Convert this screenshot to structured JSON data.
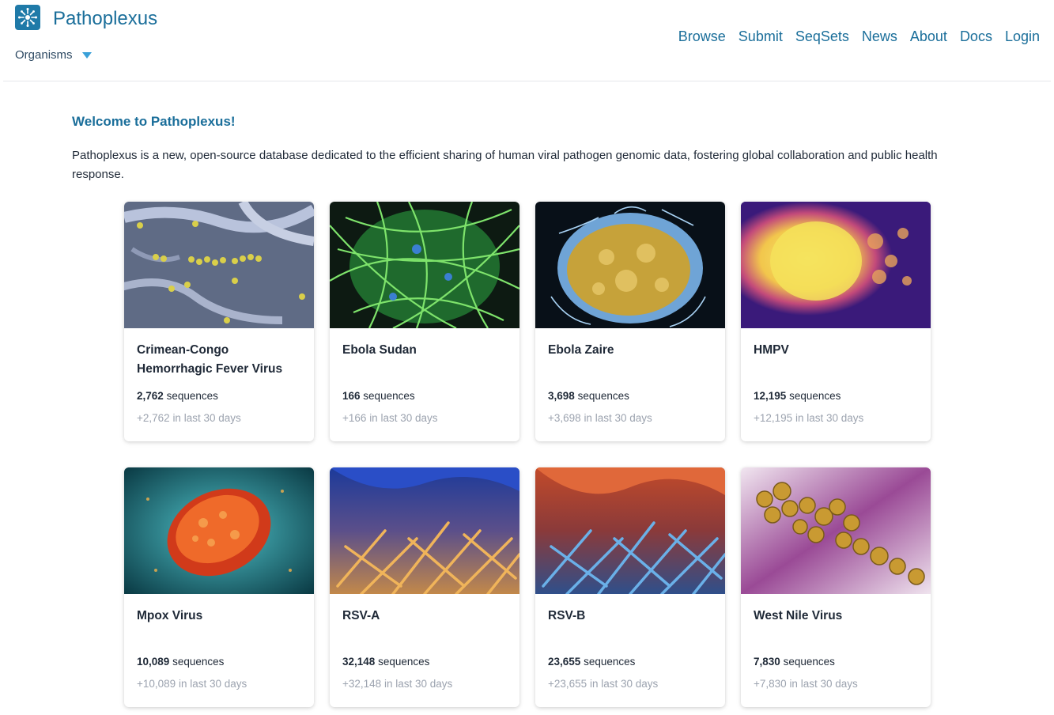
{
  "header": {
    "brand": "Pathoplexus",
    "organisms_label": "Organisms",
    "nav": [
      "Browse",
      "Submit",
      "SeqSets",
      "News",
      "About",
      "Docs",
      "Login"
    ]
  },
  "main": {
    "welcome": "Welcome to Pathoplexus!",
    "intro": "Pathoplexus is a new, open-source database dedicated to the efficient sharing of human viral pathogen genomic data, fostering global collaboration and public health response."
  },
  "cards": [
    {
      "title": "Crimean-Congo Hemorrhagic Fever Virus",
      "count": "2,762",
      "count_suffix": "sequences",
      "recent": "+2,762",
      "recent_suffix": "in last 30 days"
    },
    {
      "title": "Ebola Sudan",
      "count": "166",
      "count_suffix": "sequences",
      "recent": "+166",
      "recent_suffix": "in last 30 days"
    },
    {
      "title": "Ebola Zaire",
      "count": "3,698",
      "count_suffix": "sequences",
      "recent": "+3,698",
      "recent_suffix": "in last 30 days"
    },
    {
      "title": "HMPV",
      "count": "12,195",
      "count_suffix": "sequences",
      "recent": "+12,195",
      "recent_suffix": "in last 30 days"
    },
    {
      "title": "Mpox Virus",
      "count": "10,089",
      "count_suffix": "sequences",
      "recent": "+10,089",
      "recent_suffix": "in last 30 days"
    },
    {
      "title": "RSV-A",
      "count": "32,148",
      "count_suffix": "sequences",
      "recent": "+32,148",
      "recent_suffix": "in last 30 days"
    },
    {
      "title": "RSV-B",
      "count": "23,655",
      "count_suffix": "sequences",
      "recent": "+23,655",
      "recent_suffix": "in last 30 days"
    },
    {
      "title": "West Nile Virus",
      "count": "7,830",
      "count_suffix": "sequences",
      "recent": "+7,830",
      "recent_suffix": "in last 30 days"
    }
  ],
  "colors": {
    "brand": "#1a6e9a",
    "logo_bg": "#1f7aa8",
    "caret": "#3aa0d8",
    "muted": "#9ca3af"
  }
}
